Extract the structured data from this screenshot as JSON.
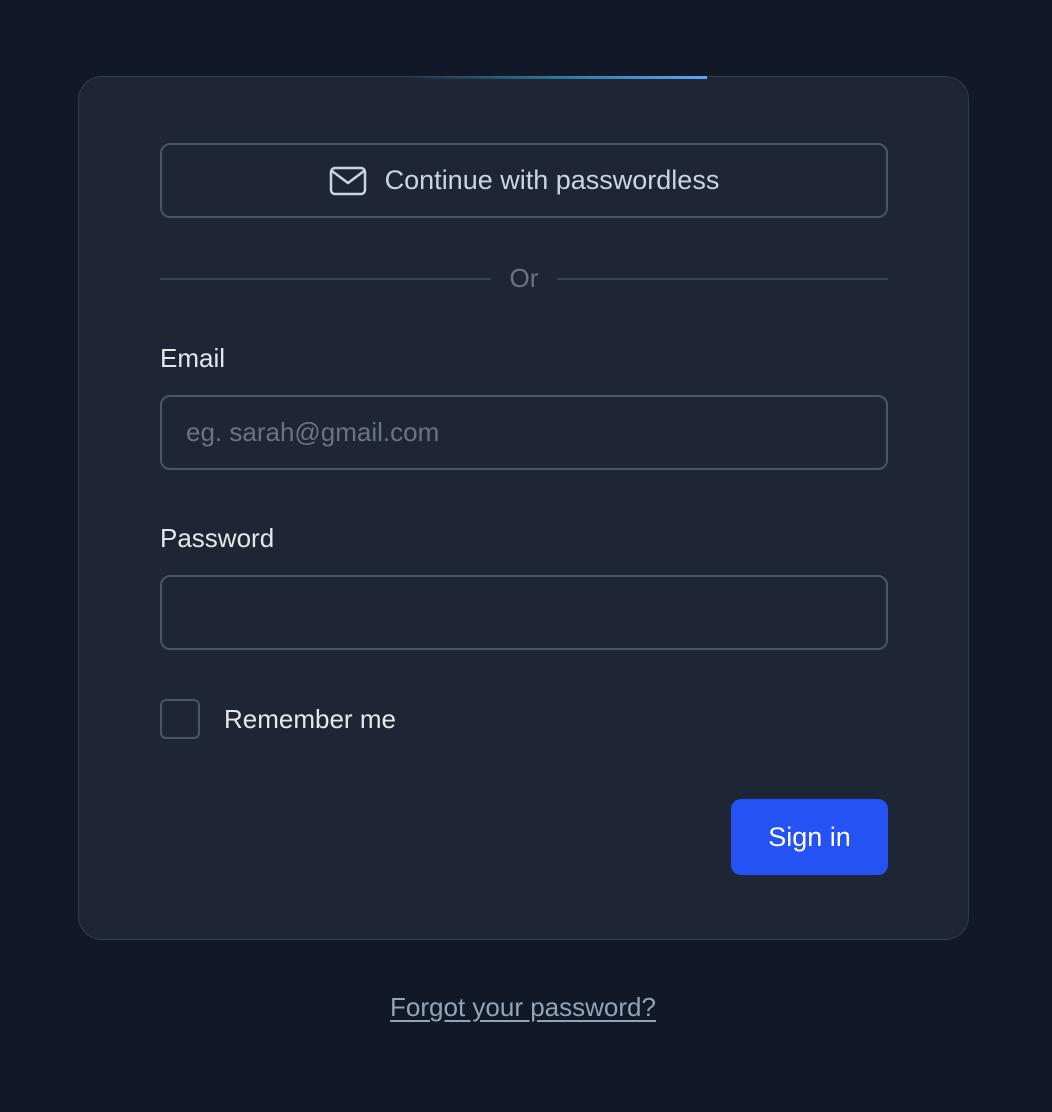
{
  "login": {
    "passwordless_button": {
      "icon": "mail-icon",
      "label": "Continue with passwordless"
    },
    "divider_text": "Or",
    "email": {
      "label": "Email",
      "placeholder": "eg. sarah@gmail.com",
      "value": ""
    },
    "password": {
      "label": "Password",
      "value": ""
    },
    "remember_me": {
      "label": "Remember me",
      "checked": false
    },
    "submit_label": "Sign in",
    "forgot_password_label": "Forgot your password?"
  },
  "colors": {
    "page_background": "#111827",
    "card_background": "#1e2636",
    "primary_button": "#2452f5",
    "border": "#4b5563"
  }
}
